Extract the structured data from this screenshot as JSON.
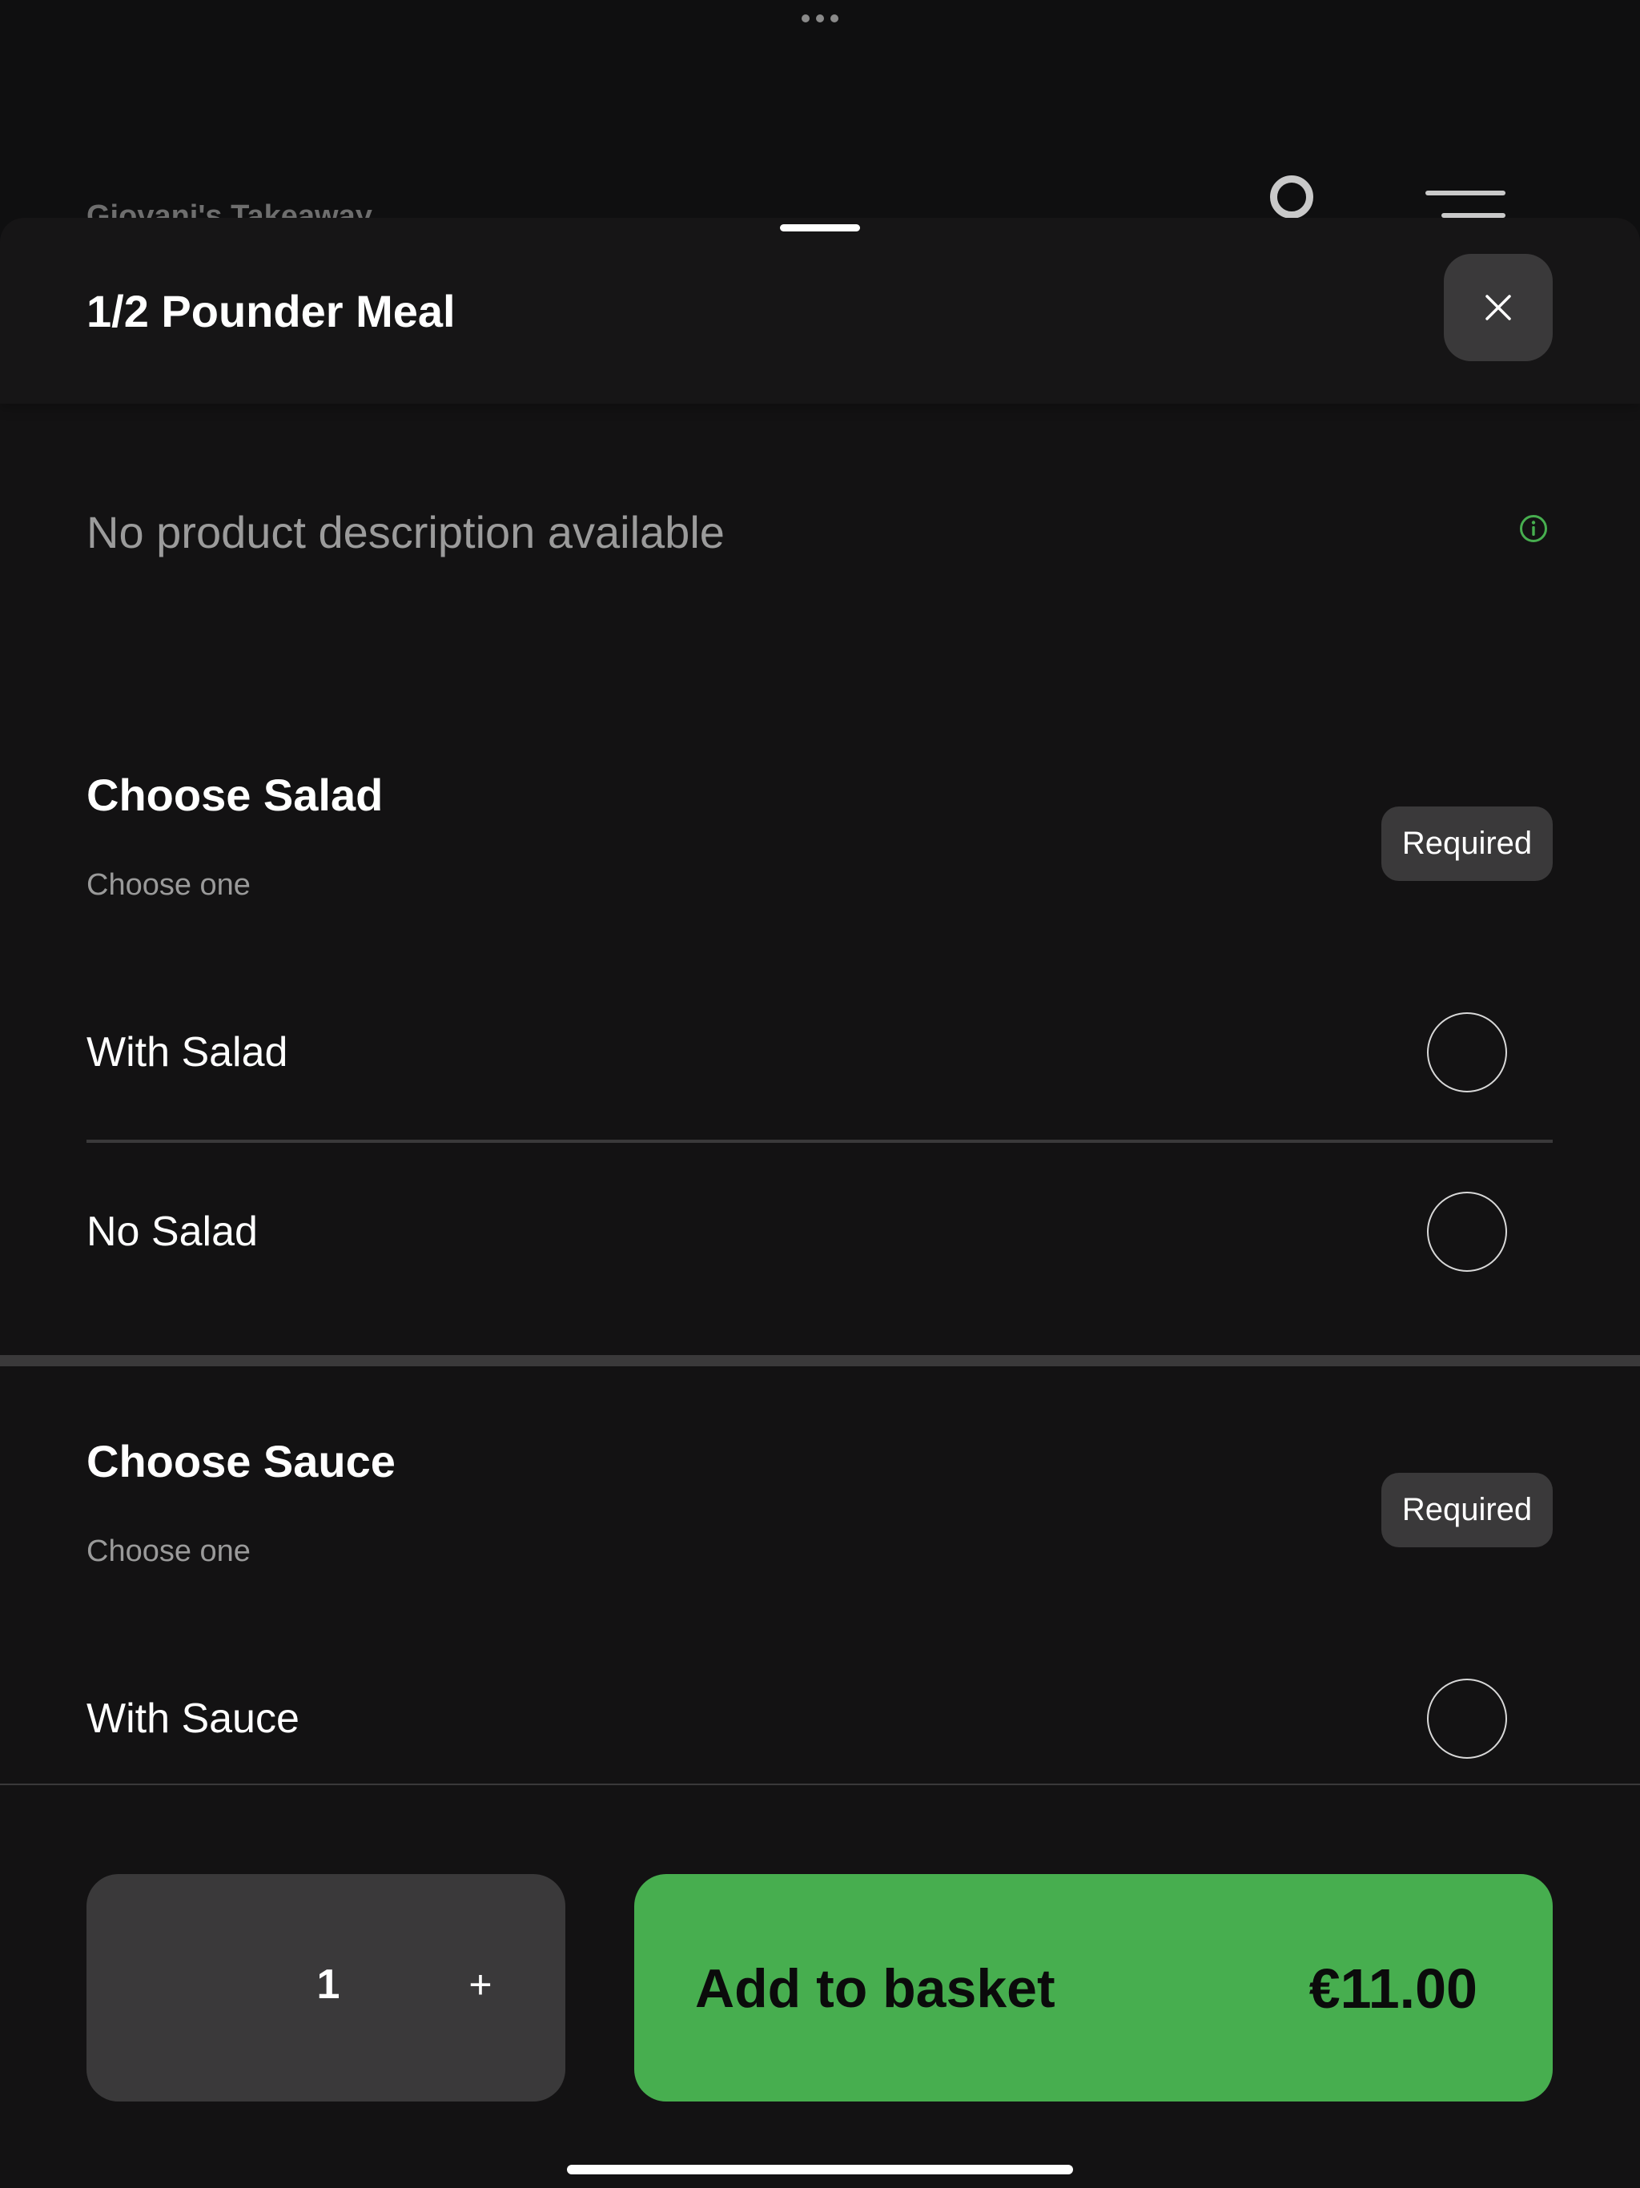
{
  "background_app": {
    "title": "Giovani's Takeaway"
  },
  "product": {
    "title": "1/2 Pounder Meal",
    "description": "No product description available"
  },
  "sections": [
    {
      "title": "Choose Salad",
      "subtitle": "Choose one",
      "badge": "Required",
      "options": [
        {
          "label": "With Salad",
          "selected": false
        },
        {
          "label": "No Salad",
          "selected": false
        }
      ]
    },
    {
      "title": "Choose Sauce",
      "subtitle": "Choose one",
      "badge": "Required",
      "options": [
        {
          "label": "With Sauce",
          "selected": false
        }
      ]
    }
  ],
  "quantity": {
    "value": "1",
    "increment_label": "+"
  },
  "add_button": {
    "label": "Add to basket",
    "price": "€11.00"
  },
  "colors": {
    "accent": "#47ae4f",
    "background": "#131213",
    "surface": "#3a393a"
  },
  "icons": {
    "close": "close-icon",
    "info": "info-icon",
    "profile": "profile-icon",
    "menu": "menu-icon"
  }
}
